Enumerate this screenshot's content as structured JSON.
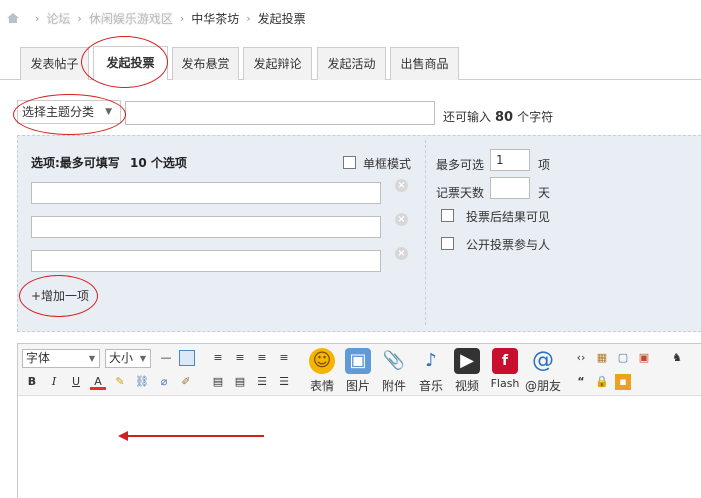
{
  "breadcrumb": {
    "items": [
      "论坛",
      "休闲娱乐游戏区",
      "中华茶坊",
      "发起投票"
    ]
  },
  "tabs": [
    {
      "label": "发表帖子"
    },
    {
      "label": "发起投票"
    },
    {
      "label": "发布悬赏"
    },
    {
      "label": "发起辩论"
    },
    {
      "label": "发起活动"
    },
    {
      "label": "出售商品"
    }
  ],
  "subject": {
    "type_select": "选择主题分类",
    "title_value": "",
    "hint_prefix": "还可输入",
    "hint_count": "80",
    "hint_suffix": "个字符"
  },
  "poll": {
    "options_title": "选项:最多可填写",
    "options_max": "10 个选项",
    "single_box_label": "单框模式",
    "add_option": "+增加一项",
    "max_choice_label": "最多可选",
    "max_choice_value": "1",
    "max_choice_unit": "项",
    "days_label": "记票天数",
    "days_value": "",
    "days_unit": "天",
    "visible_after_vote": "投票后结果可见",
    "public_voters": "公开投票参与人"
  },
  "editor": {
    "font_family": "字体",
    "font_size": "大小",
    "buttons": {
      "emoji": "表情",
      "image": "图片",
      "attach": "附件",
      "music": "音乐",
      "video": "视频",
      "flash": "Flash",
      "at": "@朋友"
    }
  },
  "colors": {
    "accent_red": "#d62020",
    "poll_bg": "#e9eef4"
  }
}
